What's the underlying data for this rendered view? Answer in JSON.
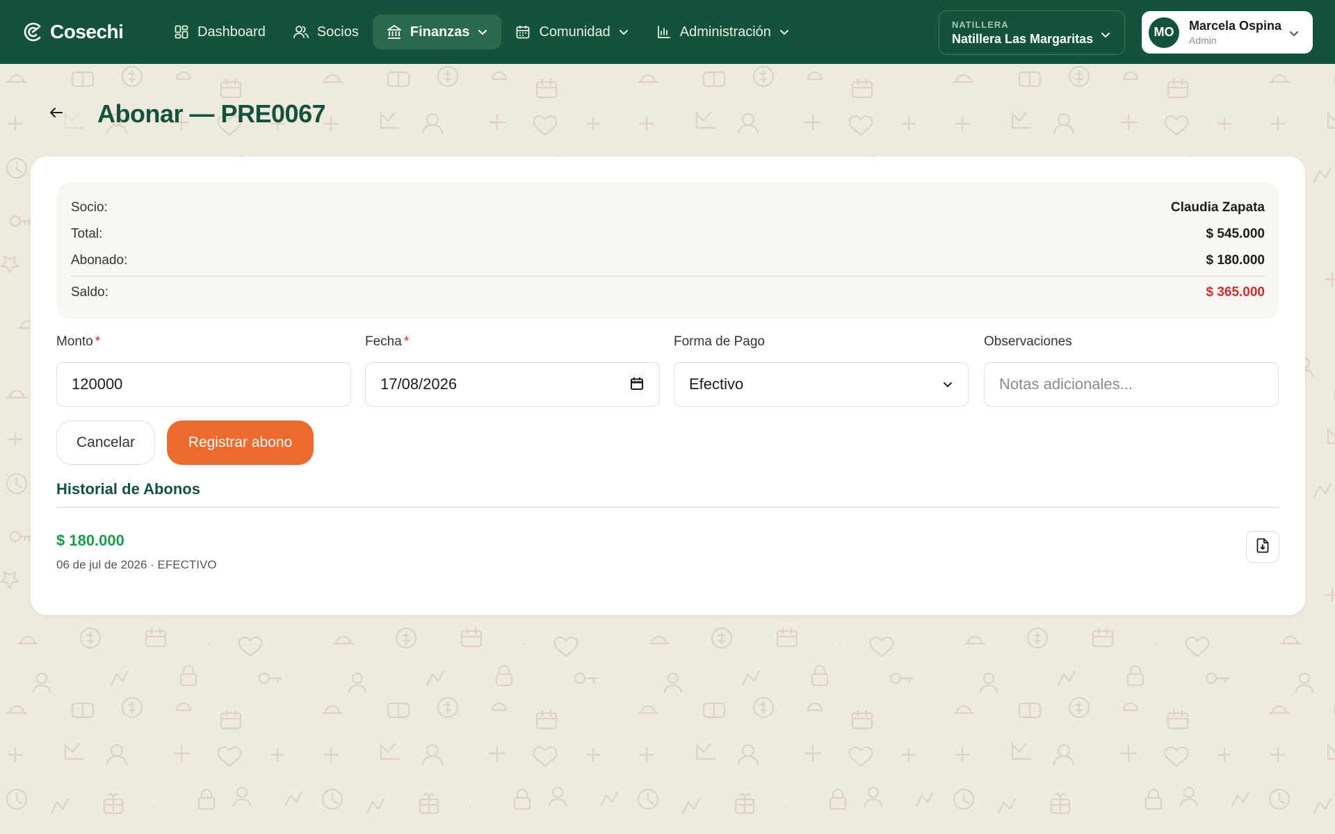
{
  "brand": {
    "name": "Cosechi"
  },
  "nav": {
    "items": [
      {
        "label": "Dashboard",
        "icon": "dashboard-grid-icon"
      },
      {
        "label": "Socios",
        "icon": "users-icon"
      },
      {
        "label": "Finanzas",
        "icon": "bank-icon",
        "active": true
      },
      {
        "label": "Comunidad",
        "icon": "calendar-icon"
      },
      {
        "label": "Administración",
        "icon": "bar-chart-icon"
      }
    ]
  },
  "org": {
    "label": "NATILLERA",
    "name": "Natillera Las Margaritas"
  },
  "user": {
    "initials": "MO",
    "name": "Marcela Ospina",
    "role": "Admin"
  },
  "page": {
    "title": "Abonar — PRE0067"
  },
  "summary": {
    "socio_label": "Socio:",
    "socio_value": "Claudia Zapata",
    "total_label": "Total:",
    "total_value": "$ 545.000",
    "abonado_label": "Abonado:",
    "abonado_value": "$ 180.000",
    "saldo_label": "Saldo:",
    "saldo_value": "$ 365.000"
  },
  "form": {
    "monto": {
      "label": "Monto",
      "value": "120000"
    },
    "fecha": {
      "label": "Fecha",
      "value": "17/08/2026"
    },
    "forma_pago": {
      "label": "Forma de Pago",
      "value": "Efectivo"
    },
    "observaciones": {
      "label": "Observaciones",
      "placeholder": "Notas adicionales..."
    },
    "required_mark": "*"
  },
  "actions": {
    "cancel": "Cancelar",
    "submit": "Registrar abono"
  },
  "history": {
    "title": "Historial de Abonos",
    "items": [
      {
        "amount": "$ 180.000",
        "meta": "06 de jul de 2026 · EFECTIVO"
      }
    ]
  },
  "colors": {
    "primary": "#15523c",
    "accent": "#ee6b2f",
    "danger": "#cc2e2e",
    "success": "#1e9a4e",
    "background": "#eeeade"
  }
}
